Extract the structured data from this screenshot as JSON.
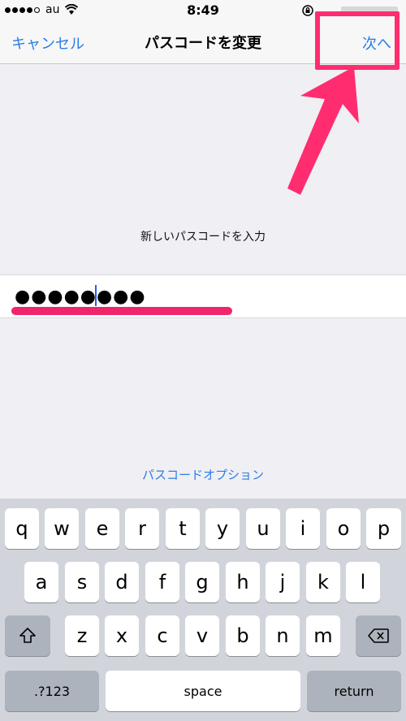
{
  "status_bar": {
    "carrier": "au",
    "time": "8:49"
  },
  "nav": {
    "cancel": "キャンセル",
    "title": "パスコードを変更",
    "next": "次へ"
  },
  "prompt": "新しいパスコードを入力",
  "passcode": {
    "masked": "●●●●●●●●"
  },
  "options_link": "パスコードオプション",
  "keyboard": {
    "row1": [
      "q",
      "w",
      "e",
      "r",
      "t",
      "y",
      "u",
      "i",
      "o",
      "p"
    ],
    "row2": [
      "a",
      "s",
      "d",
      "f",
      "g",
      "h",
      "j",
      "k",
      "l"
    ],
    "row3": [
      "z",
      "x",
      "c",
      "v",
      "b",
      "n",
      "m"
    ],
    "numbers": ".?123",
    "space": "space",
    "return": "return"
  },
  "colors": {
    "accent": "#2b7de9",
    "annotation": "#ff2d6f"
  }
}
